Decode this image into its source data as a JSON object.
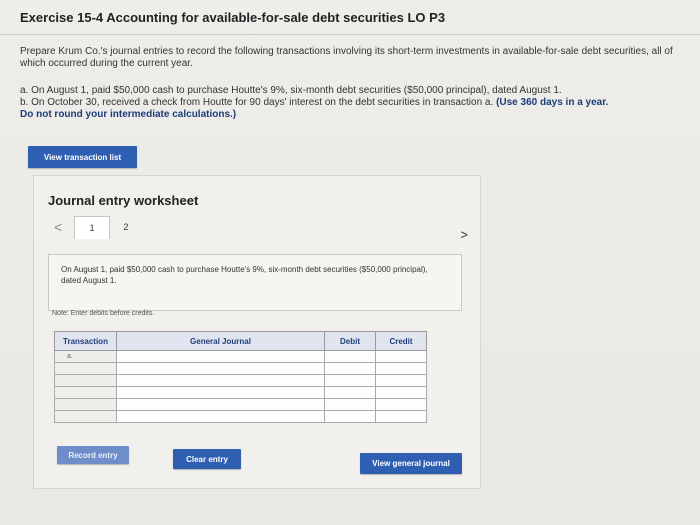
{
  "header": {
    "title": "Exercise 15-4 Accounting for available-for-sale debt securities LO P3"
  },
  "instructions": {
    "intro": "Prepare Krum Co.'s journal entries to record the following transactions involving its short-term investments in available-for-sale debt securities, all of which occurred during the current year.",
    "item_a": "a. On August 1, paid $50,000 cash to purchase Houtte's 9%, six-month debt securities ($50,000 principal), dated August 1.",
    "item_b": "b. On October 30, received a check from Houtte for 90 days' interest on the debt securities in transaction a.",
    "item_b_emphasis": "(Use 360 days in a year.",
    "item_c": "Do not round your intermediate calculations.)"
  },
  "buttons": {
    "view_transaction_list": "View transaction list",
    "record_entry": "Record entry",
    "clear_entry": "Clear entry",
    "view_general_journal": "View general journal"
  },
  "worksheet": {
    "title": "Journal entry worksheet",
    "nav_prev": "<",
    "nav_next": ">",
    "tabs": [
      "1",
      "2"
    ],
    "description": "On August 1, paid $50,000 cash to purchase Houtte's 9%, six-month debt securities ($50,000 principal), dated August 1.",
    "note": "Note: Enter debits before credits.",
    "table": {
      "headers": [
        "Transaction",
        "General Journal",
        "Debit",
        "Credit"
      ],
      "rows": [
        {
          "transaction": "a.",
          "account": "",
          "debit": "",
          "credit": ""
        },
        {
          "transaction": "",
          "account": "",
          "debit": "",
          "credit": ""
        },
        {
          "transaction": "",
          "account": "",
          "debit": "",
          "credit": ""
        },
        {
          "transaction": "",
          "account": "",
          "debit": "",
          "credit": ""
        },
        {
          "transaction": "",
          "account": "",
          "debit": "",
          "credit": ""
        },
        {
          "transaction": "",
          "account": "",
          "debit": "",
          "credit": ""
        }
      ]
    }
  }
}
